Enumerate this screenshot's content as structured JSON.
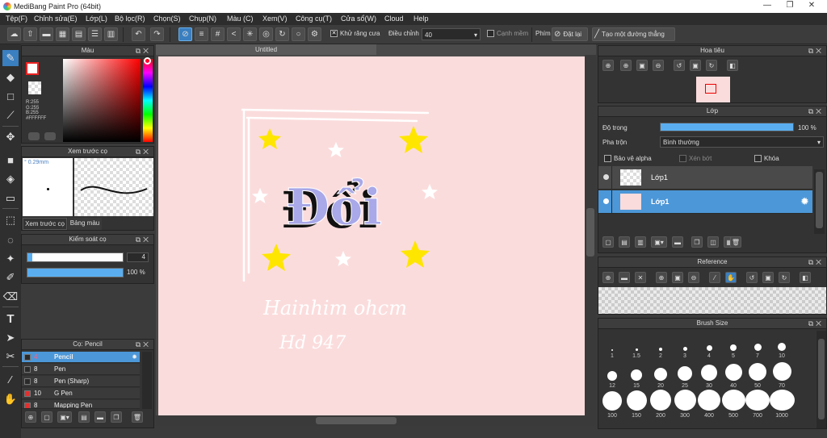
{
  "window": {
    "title": "MediBang Paint Pro (64bit)",
    "minimize": "—",
    "restore": "❐",
    "close": "✕"
  },
  "menu": [
    "Tệp(F)",
    "Chỉnh sửa(E)",
    "Lớp(L)",
    "Bộ lọc(R)",
    "Chọn(S)",
    "Chụp(N)",
    "Màu (C)",
    "Xem(V)",
    "Công cụ(T)",
    "Cửa sổ(W)",
    "Cloud",
    "Help"
  ],
  "toolbar": {
    "antialias_label": "Khử răng cưa",
    "correction_label": "Điều chỉnh",
    "correction_value": "40",
    "edge_label": "Cạnh mềm",
    "key_label": "Phím",
    "set_label": "Đặt lại",
    "straight_line_label": "Tạo một đường thẳng"
  },
  "color_panel": {
    "title": "Màu",
    "r": "R:255",
    "g": "G:255",
    "b": "B:255",
    "hex": "#FFFFFF",
    "foreground": "#FFFFFF"
  },
  "brush_preview_panel": {
    "title": "Xem trước cọ",
    "size": "0.29mm",
    "tab1": "Xem trước cọ",
    "tab2": "Bảng màu"
  },
  "brush_control_panel": {
    "title": "Kiểm soát cọ",
    "size_value": "4",
    "opacity_value": "100 %",
    "opacity": 1.0
  },
  "brush_list_panel": {
    "title": "Cọ: Pencil",
    "items": [
      {
        "size": "4",
        "name": "Pencil",
        "color": "#2a2a2a",
        "selected": true
      },
      {
        "size": "8",
        "name": "Pen",
        "color": "#2a2a2a",
        "selected": false
      },
      {
        "size": "8",
        "name": "Pen (Sharp)",
        "color": "#2a2a2a",
        "selected": false
      },
      {
        "size": "10",
        "name": "G Pen",
        "color": "#e03030",
        "selected": false
      },
      {
        "size": "8",
        "name": "Mapping Pen",
        "color": "#e03030",
        "selected": false
      }
    ]
  },
  "canvas": {
    "tab": "Untitled",
    "background": "#FBDCDC",
    "title_text": "Đổi",
    "signature_line1": "Hainhim ohcm",
    "signature_line2": "Hd 947"
  },
  "navigator_panel": {
    "title": "Hoa tiêu"
  },
  "layer_panel": {
    "title": "Lớp",
    "opacity_label": "Độ trong",
    "opacity_value": "100 %",
    "opacity": 1.0,
    "blend_label": "Pha trộn",
    "blend_value": "Bình thường",
    "protect_alpha": "Bảo vệ alpha",
    "clip": "Xén bớt",
    "lock": "Khóa",
    "layers": [
      {
        "name": "Lớp1",
        "selected": false
      },
      {
        "name": "Lớp1",
        "selected": true
      }
    ]
  },
  "reference_panel": {
    "title": "Reference"
  },
  "brush_size_panel": {
    "title": "Brush Size",
    "sizes": [
      "1",
      "1.5",
      "2",
      "3",
      "4",
      "5",
      "7",
      "10",
      "12",
      "15",
      "20",
      "25",
      "30",
      "40",
      "50",
      "70",
      "100",
      "150",
      "200",
      "300",
      "400",
      "500",
      "700",
      "1000"
    ]
  },
  "colors": {
    "accent": "#3A7FC0",
    "star": "#FFE600"
  }
}
